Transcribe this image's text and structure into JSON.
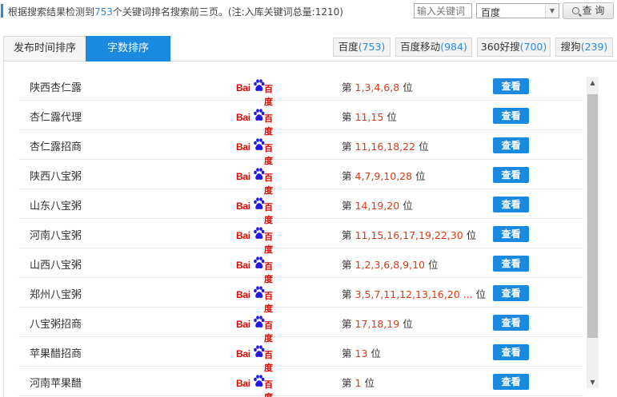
{
  "summary": {
    "prefix": "根据搜索结果检测到",
    "count": "753",
    "suffix": "个关键词排名搜索前三页。(注:入库关键词总量:1210)"
  },
  "search": {
    "placeholder": "输入关键词"
  },
  "engine_select": {
    "value": "百度"
  },
  "query_button": {
    "label": "查 询"
  },
  "tabs": [
    {
      "label": "发布时间排序"
    },
    {
      "label": "字数排序"
    }
  ],
  "engine_tabs": [
    {
      "name": "百度",
      "count": "(753)"
    },
    {
      "name": "百度移动",
      "count": "(984)"
    },
    {
      "name": "360好搜",
      "count": "(700)"
    },
    {
      "name": "搜狗",
      "count": "(239)"
    }
  ],
  "engine_logo": {
    "left": "Bai",
    "right": "百度",
    "icon": "baidu-paw-icon"
  },
  "rank_prefix": "第",
  "rank_suffix": "位",
  "view_label": "查看",
  "rows": [
    {
      "keyword": "陕西杏仁露",
      "ranks": "1,3,4,6,8"
    },
    {
      "keyword": "杏仁露代理",
      "ranks": "11,15"
    },
    {
      "keyword": "杏仁露招商",
      "ranks": "11,16,18,22"
    },
    {
      "keyword": "陕西八宝粥",
      "ranks": "4,7,9,10,28"
    },
    {
      "keyword": "山东八宝粥",
      "ranks": "14,19,20"
    },
    {
      "keyword": "河南八宝粥",
      "ranks": "11,15,16,17,19,22,30"
    },
    {
      "keyword": "山西八宝粥",
      "ranks": "1,2,3,6,8,9,10"
    },
    {
      "keyword": "郑州八宝粥",
      "ranks": "3,5,7,11,12,13,16,20 ..."
    },
    {
      "keyword": "八宝粥招商",
      "ranks": "17,18,19"
    },
    {
      "keyword": "苹果醋招商",
      "ranks": "13"
    },
    {
      "keyword": "河南苹果醋",
      "ranks": "1"
    }
  ],
  "colors": {
    "accent": "#1a8ae0",
    "rank": "#e03a12",
    "baidu_red": "#e10602",
    "baidu_blue": "#2319dc"
  }
}
